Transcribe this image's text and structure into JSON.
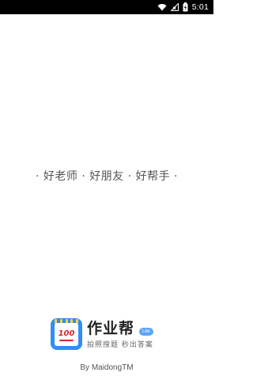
{
  "status_bar": {
    "time": "5:01",
    "icons": [
      "wifi-icon",
      "signal-icon",
      "battery-charging-icon"
    ]
  },
  "splash": {
    "slogan": "· 好老师 · 好朋友 · 好帮手 ·",
    "app_name": "作业帮",
    "badge": "Lite",
    "tagline": "拍照搜题  秒出答案",
    "icon_score": "100",
    "credit": "By MaidongTM"
  },
  "colors": {
    "status_bar_bg": "#000000",
    "brand_blue": "#2f8ef5",
    "score_red": "#d8262c",
    "ring_yellow": "#ffd23f",
    "badge_blue": "#5aa5f5"
  }
}
